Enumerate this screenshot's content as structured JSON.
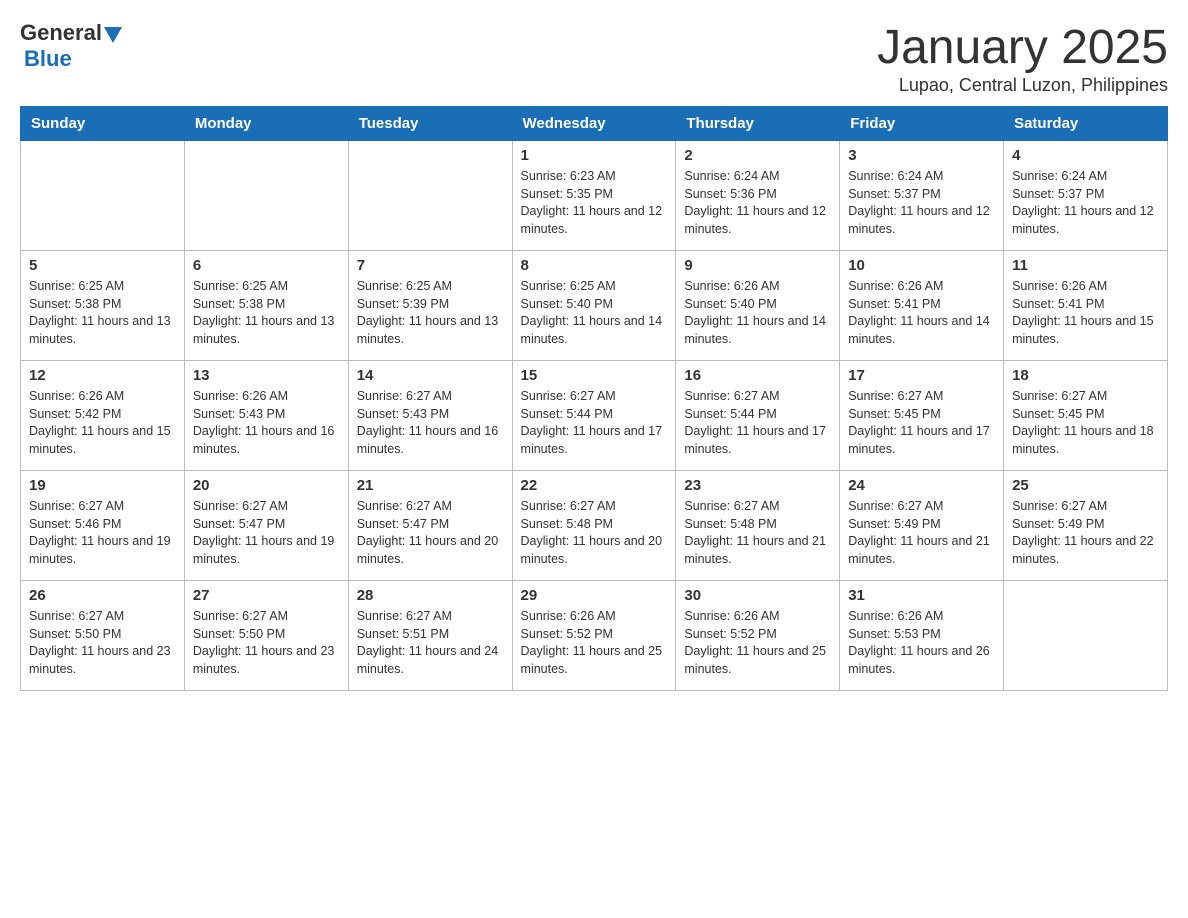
{
  "header": {
    "logo_general": "General",
    "logo_blue": "Blue",
    "month_title": "January 2025",
    "location": "Lupao, Central Luzon, Philippines"
  },
  "days_of_week": [
    "Sunday",
    "Monday",
    "Tuesday",
    "Wednesday",
    "Thursday",
    "Friday",
    "Saturday"
  ],
  "weeks": [
    {
      "days": [
        {
          "number": "",
          "info": ""
        },
        {
          "number": "",
          "info": ""
        },
        {
          "number": "",
          "info": ""
        },
        {
          "number": "1",
          "info": "Sunrise: 6:23 AM\nSunset: 5:35 PM\nDaylight: 11 hours and 12 minutes."
        },
        {
          "number": "2",
          "info": "Sunrise: 6:24 AM\nSunset: 5:36 PM\nDaylight: 11 hours and 12 minutes."
        },
        {
          "number": "3",
          "info": "Sunrise: 6:24 AM\nSunset: 5:37 PM\nDaylight: 11 hours and 12 minutes."
        },
        {
          "number": "4",
          "info": "Sunrise: 6:24 AM\nSunset: 5:37 PM\nDaylight: 11 hours and 12 minutes."
        }
      ]
    },
    {
      "days": [
        {
          "number": "5",
          "info": "Sunrise: 6:25 AM\nSunset: 5:38 PM\nDaylight: 11 hours and 13 minutes."
        },
        {
          "number": "6",
          "info": "Sunrise: 6:25 AM\nSunset: 5:38 PM\nDaylight: 11 hours and 13 minutes."
        },
        {
          "number": "7",
          "info": "Sunrise: 6:25 AM\nSunset: 5:39 PM\nDaylight: 11 hours and 13 minutes."
        },
        {
          "number": "8",
          "info": "Sunrise: 6:25 AM\nSunset: 5:40 PM\nDaylight: 11 hours and 14 minutes."
        },
        {
          "number": "9",
          "info": "Sunrise: 6:26 AM\nSunset: 5:40 PM\nDaylight: 11 hours and 14 minutes."
        },
        {
          "number": "10",
          "info": "Sunrise: 6:26 AM\nSunset: 5:41 PM\nDaylight: 11 hours and 14 minutes."
        },
        {
          "number": "11",
          "info": "Sunrise: 6:26 AM\nSunset: 5:41 PM\nDaylight: 11 hours and 15 minutes."
        }
      ]
    },
    {
      "days": [
        {
          "number": "12",
          "info": "Sunrise: 6:26 AM\nSunset: 5:42 PM\nDaylight: 11 hours and 15 minutes."
        },
        {
          "number": "13",
          "info": "Sunrise: 6:26 AM\nSunset: 5:43 PM\nDaylight: 11 hours and 16 minutes."
        },
        {
          "number": "14",
          "info": "Sunrise: 6:27 AM\nSunset: 5:43 PM\nDaylight: 11 hours and 16 minutes."
        },
        {
          "number": "15",
          "info": "Sunrise: 6:27 AM\nSunset: 5:44 PM\nDaylight: 11 hours and 17 minutes."
        },
        {
          "number": "16",
          "info": "Sunrise: 6:27 AM\nSunset: 5:44 PM\nDaylight: 11 hours and 17 minutes."
        },
        {
          "number": "17",
          "info": "Sunrise: 6:27 AM\nSunset: 5:45 PM\nDaylight: 11 hours and 17 minutes."
        },
        {
          "number": "18",
          "info": "Sunrise: 6:27 AM\nSunset: 5:45 PM\nDaylight: 11 hours and 18 minutes."
        }
      ]
    },
    {
      "days": [
        {
          "number": "19",
          "info": "Sunrise: 6:27 AM\nSunset: 5:46 PM\nDaylight: 11 hours and 19 minutes."
        },
        {
          "number": "20",
          "info": "Sunrise: 6:27 AM\nSunset: 5:47 PM\nDaylight: 11 hours and 19 minutes."
        },
        {
          "number": "21",
          "info": "Sunrise: 6:27 AM\nSunset: 5:47 PM\nDaylight: 11 hours and 20 minutes."
        },
        {
          "number": "22",
          "info": "Sunrise: 6:27 AM\nSunset: 5:48 PM\nDaylight: 11 hours and 20 minutes."
        },
        {
          "number": "23",
          "info": "Sunrise: 6:27 AM\nSunset: 5:48 PM\nDaylight: 11 hours and 21 minutes."
        },
        {
          "number": "24",
          "info": "Sunrise: 6:27 AM\nSunset: 5:49 PM\nDaylight: 11 hours and 21 minutes."
        },
        {
          "number": "25",
          "info": "Sunrise: 6:27 AM\nSunset: 5:49 PM\nDaylight: 11 hours and 22 minutes."
        }
      ]
    },
    {
      "days": [
        {
          "number": "26",
          "info": "Sunrise: 6:27 AM\nSunset: 5:50 PM\nDaylight: 11 hours and 23 minutes."
        },
        {
          "number": "27",
          "info": "Sunrise: 6:27 AM\nSunset: 5:50 PM\nDaylight: 11 hours and 23 minutes."
        },
        {
          "number": "28",
          "info": "Sunrise: 6:27 AM\nSunset: 5:51 PM\nDaylight: 11 hours and 24 minutes."
        },
        {
          "number": "29",
          "info": "Sunrise: 6:26 AM\nSunset: 5:52 PM\nDaylight: 11 hours and 25 minutes."
        },
        {
          "number": "30",
          "info": "Sunrise: 6:26 AM\nSunset: 5:52 PM\nDaylight: 11 hours and 25 minutes."
        },
        {
          "number": "31",
          "info": "Sunrise: 6:26 AM\nSunset: 5:53 PM\nDaylight: 11 hours and 26 minutes."
        },
        {
          "number": "",
          "info": ""
        }
      ]
    }
  ]
}
